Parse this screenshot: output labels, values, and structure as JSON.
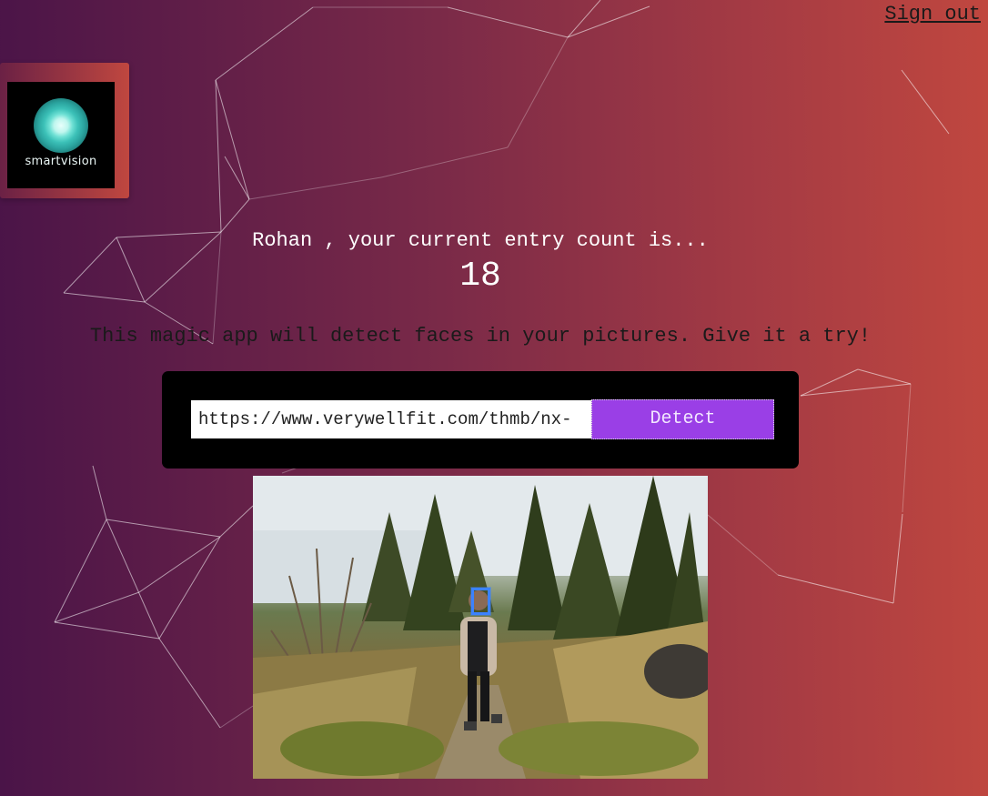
{
  "header": {
    "signout_label": "Sign out"
  },
  "logo": {
    "text": "smartvision",
    "icon": "smartvision-logo-icon"
  },
  "greeting": {
    "user": "Rohan",
    "text": "Rohan , your current entry count is...",
    "count": "18"
  },
  "intro": {
    "text": "This magic app will detect faces in your pictures. Give it a try!"
  },
  "form": {
    "url_value": "https://www.verywellfit.com/thmb/nx-",
    "detect_label": "Detect"
  },
  "colors": {
    "bg_start": "#4a1448",
    "bg_end": "#c0473f",
    "button": "#9a3fe6",
    "face_box": "#3b82ff"
  }
}
